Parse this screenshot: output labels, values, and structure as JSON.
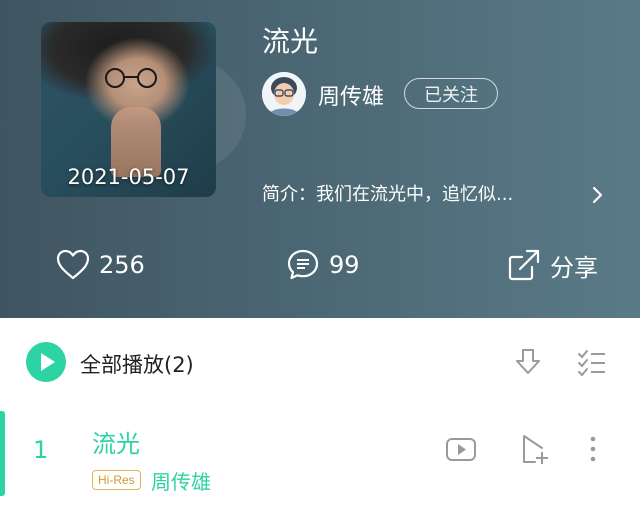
{
  "album": {
    "title": "流光",
    "release_date": "2021-05-07",
    "cover_icon": "album-cover-image"
  },
  "artist": {
    "name": "周传雄",
    "follow_label": "已关注"
  },
  "intro": {
    "text": "简介：我们在流光中，追忆似..."
  },
  "actions": {
    "like_count": "256",
    "comment_count": "99",
    "share_label": "分享"
  },
  "list_toolbar": {
    "play_all_label": "全部播放(2)"
  },
  "tracks": [
    {
      "index": "1",
      "title": "流光",
      "quality_badge": "Hi-Res",
      "artist": "周传雄"
    }
  ],
  "colors": {
    "accent": "#2ed3a3",
    "header_bg": "#4b6673",
    "badge_gold": "#d29b2a"
  }
}
